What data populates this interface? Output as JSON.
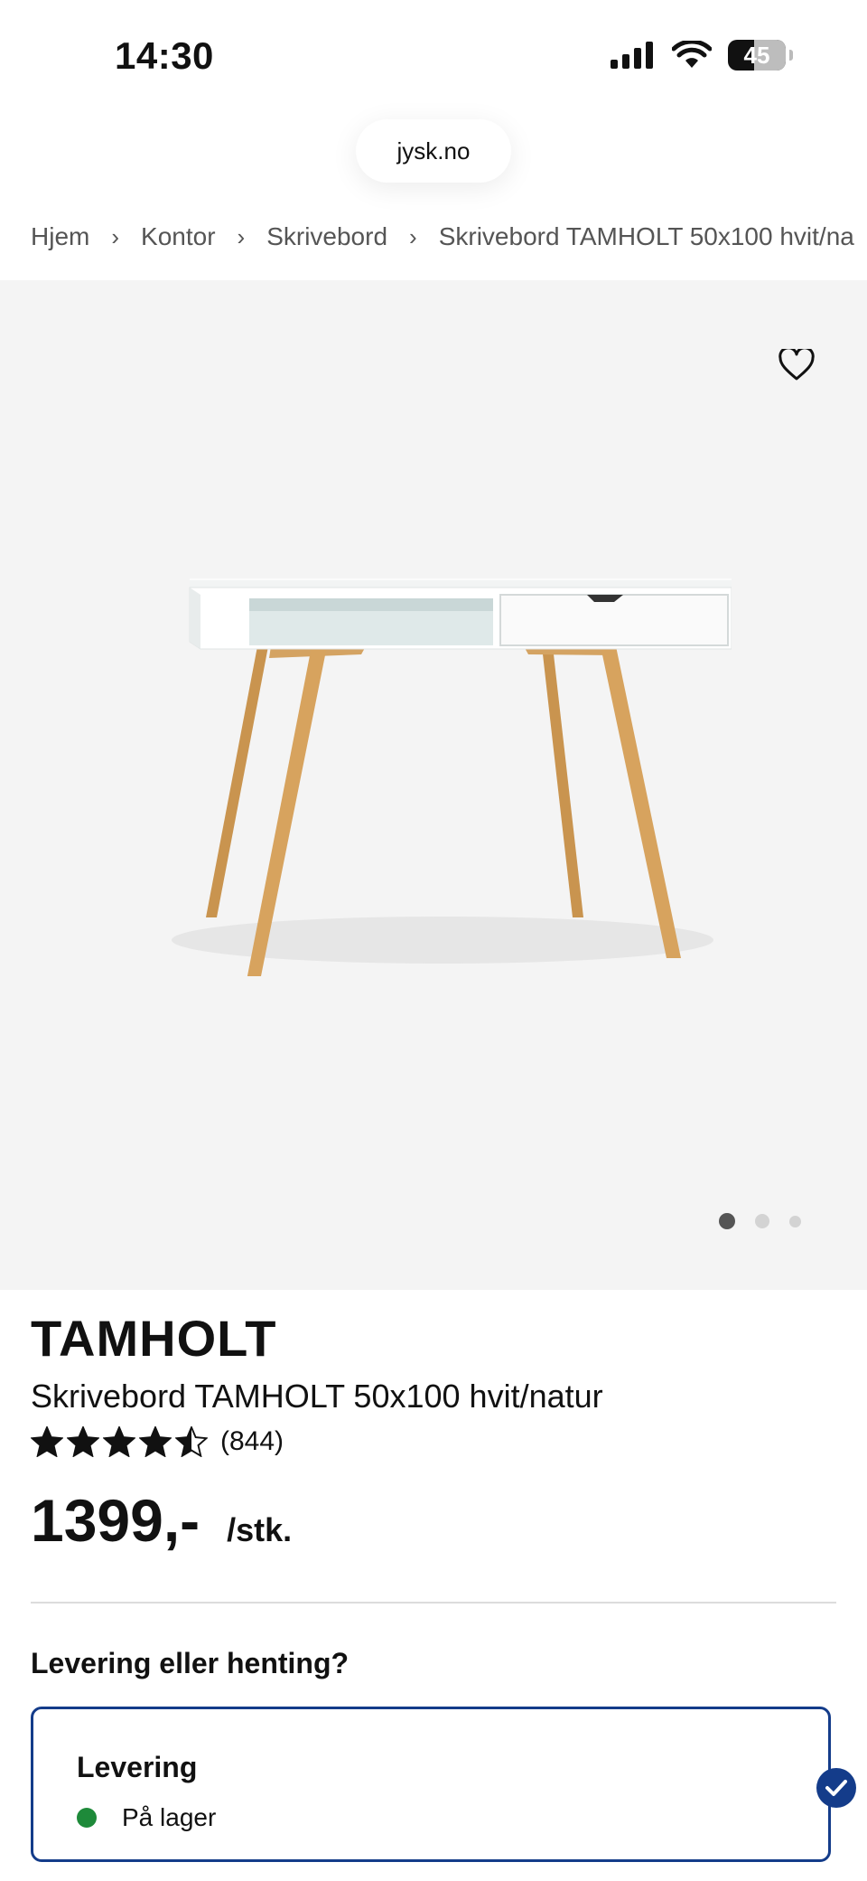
{
  "status_bar": {
    "time": "14:30",
    "battery_level": "45",
    "battery_fraction": 0.45,
    "icons": [
      "cellular-signal-icon",
      "wifi-icon",
      "battery-icon"
    ]
  },
  "browser": {
    "url": "jysk.no"
  },
  "breadcrumb": [
    {
      "label": "Hjem"
    },
    {
      "label": "Kontor"
    },
    {
      "label": "Skrivebord"
    },
    {
      "label": "Skrivebord TAMHOLT 50x100 hvit/na"
    }
  ],
  "gallery": {
    "favorite_icon": "heart-outline-icon",
    "image_count": 3,
    "active_index": 0
  },
  "product": {
    "brand": "TAMHOLT",
    "name": "Skrivebord TAMHOLT 50x100 hvit/natur",
    "rating": 4.5,
    "review_count": "(844)",
    "price": "1399,-",
    "unit": "/stk."
  },
  "delivery": {
    "heading": "Levering eller henting?",
    "option_title": "Levering",
    "stock_status": "På lager",
    "selected": true
  },
  "colors": {
    "accent": "#143c8a",
    "in_stock": "#1e8a3a",
    "gallery_bg": "#f4f4f4"
  }
}
